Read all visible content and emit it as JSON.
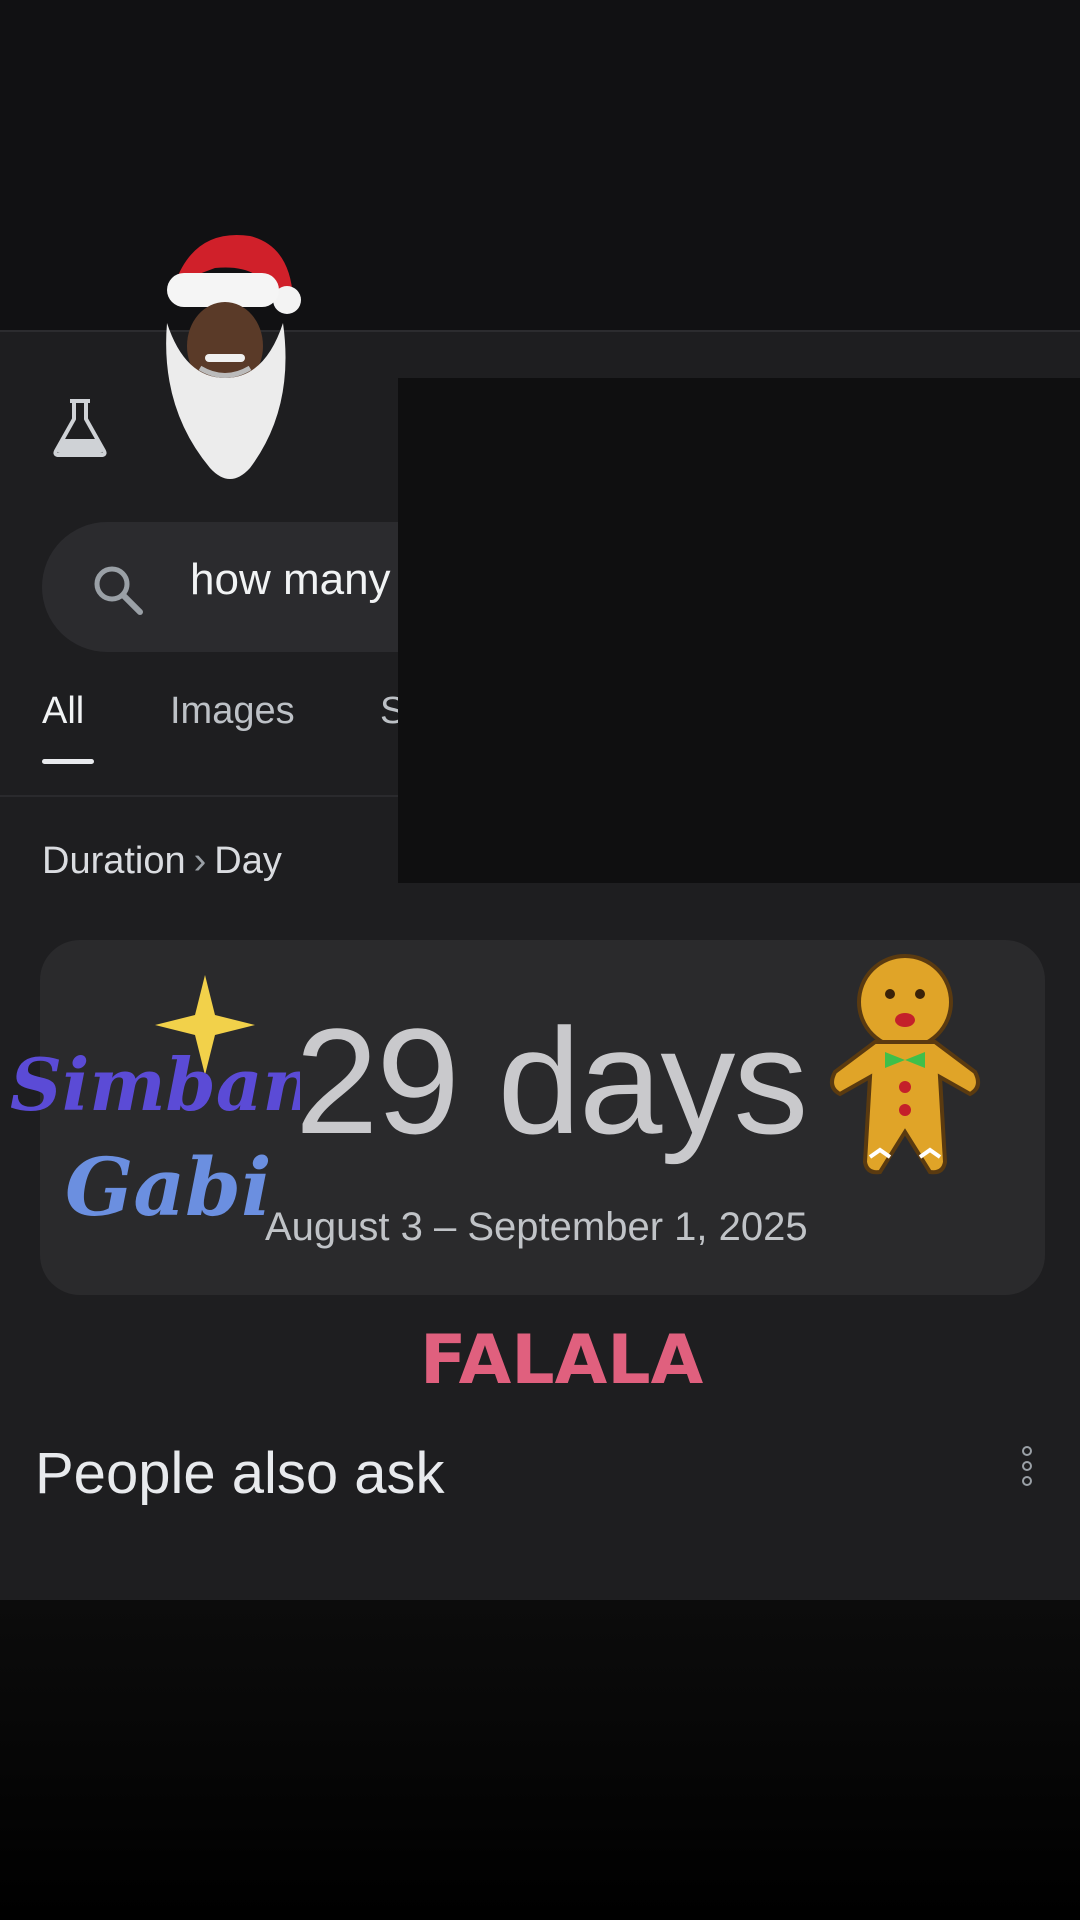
{
  "search": {
    "query": "how many"
  },
  "tabs": [
    {
      "label": "All"
    },
    {
      "label": "Images"
    },
    {
      "label": "S"
    }
  ],
  "breadcrumb": {
    "parent": "Duration",
    "separator": "›",
    "child": "Day"
  },
  "answer": {
    "value": "29 days",
    "range": "August 3 – September 1, 2025"
  },
  "stickers": {
    "simbang": "Simbang Gabi",
    "falala": "FALALA"
  },
  "people_also_ask": {
    "title": "People also ask"
  },
  "icons": [
    "labs-flask-icon",
    "search-icon",
    "more-vert-icon"
  ],
  "colors": {
    "background": "#1e1e20",
    "card": "#2a2a2c",
    "text": "#e8eaed"
  }
}
